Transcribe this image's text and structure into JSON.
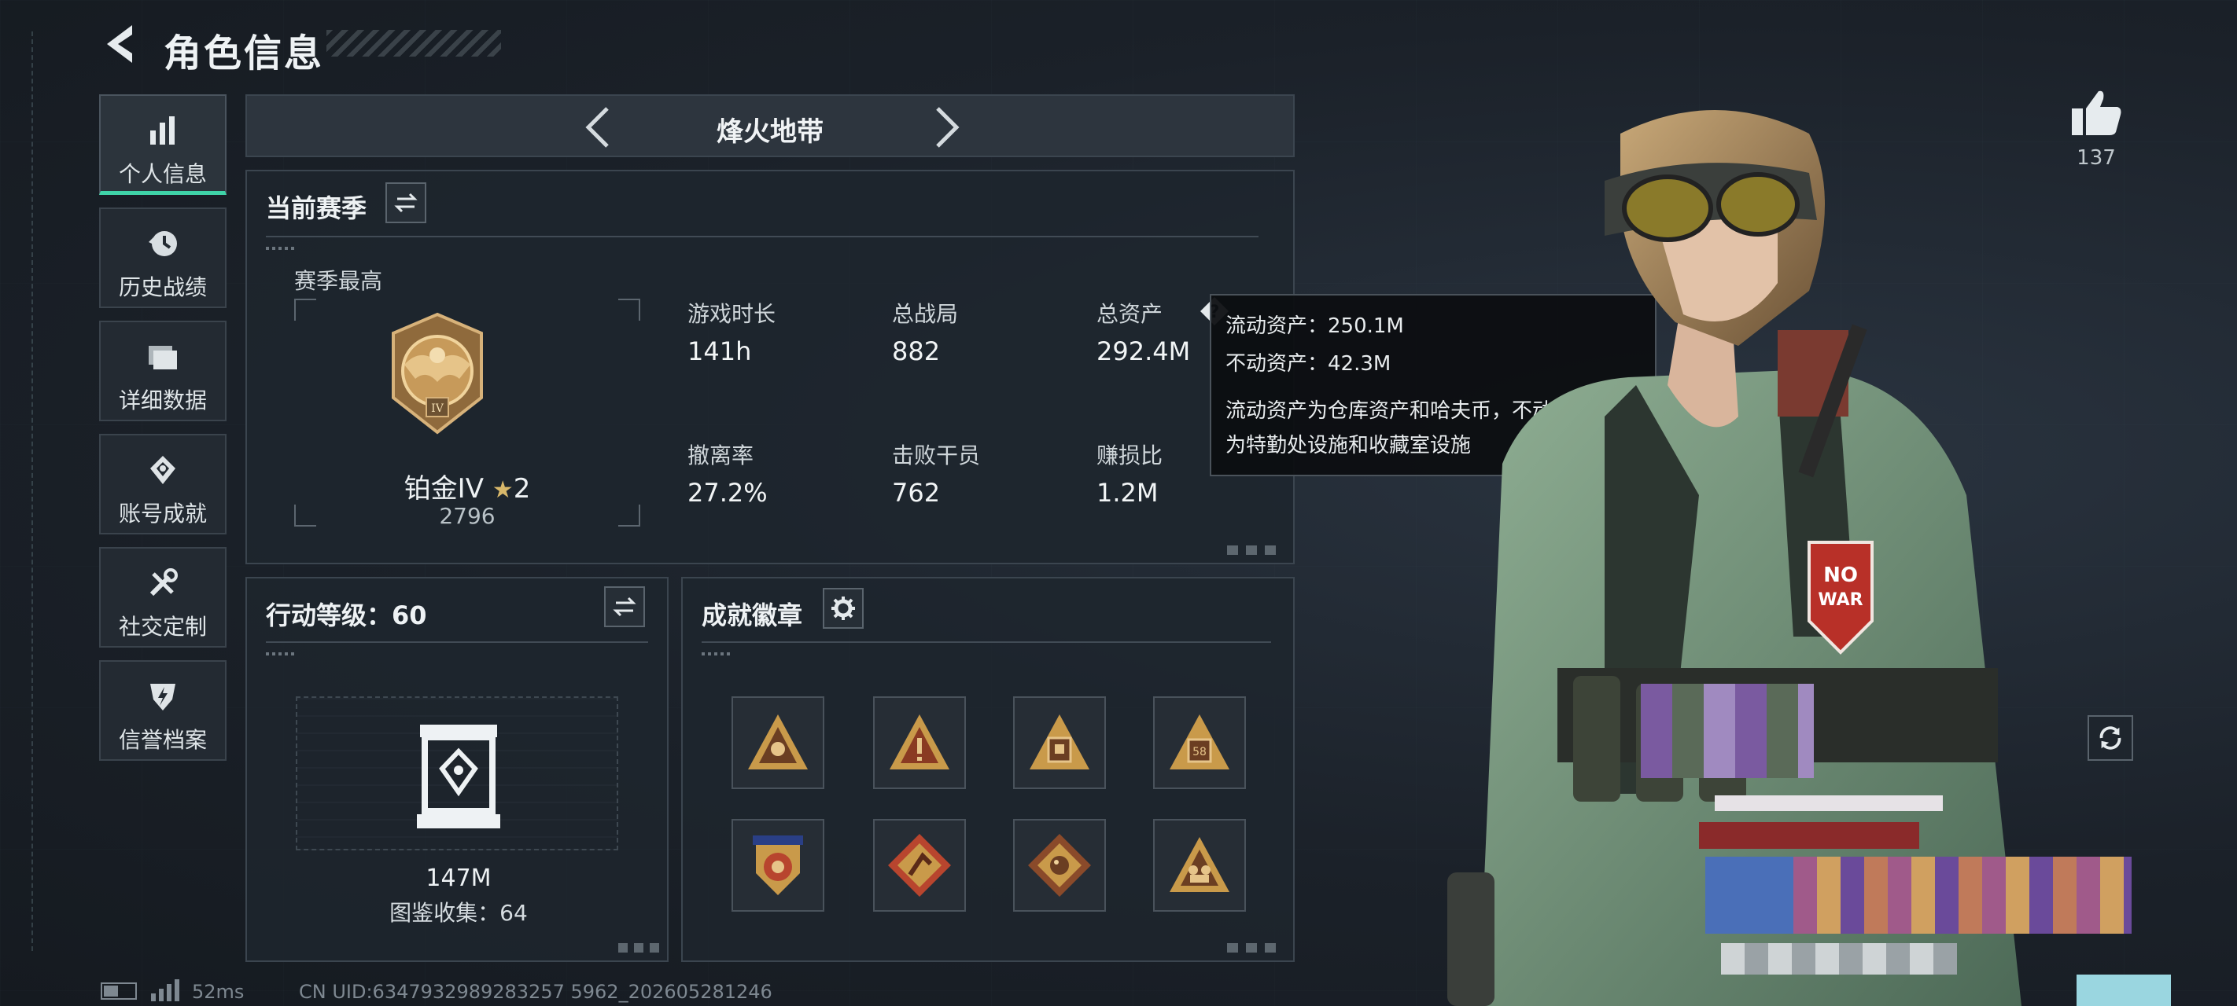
{
  "header": {
    "title": "角色信息"
  },
  "sidebar": {
    "items": [
      {
        "label": "个人信息",
        "icon": "bar-chart-icon",
        "active": true
      },
      {
        "label": "历史战绩",
        "icon": "history-clock-icon",
        "active": false
      },
      {
        "label": "详细数据",
        "icon": "folder-icon",
        "active": false
      },
      {
        "label": "账号成就",
        "icon": "achievement-icon",
        "active": false
      },
      {
        "label": "社交定制",
        "icon": "tools-icon",
        "active": false
      },
      {
        "label": "信誉档案",
        "icon": "shield-bolt-icon",
        "active": false
      }
    ]
  },
  "game_tab": {
    "name": "烽火地带"
  },
  "season": {
    "title": "当前赛季",
    "best_label": "赛季最高",
    "rank_name": "铂金IV",
    "rank_stars": "2",
    "rank_score": "2796",
    "stats": [
      {
        "label": "游戏时长",
        "value": "141h"
      },
      {
        "label": "总战局",
        "value": "882"
      },
      {
        "label": "总资产",
        "value": "292.4M"
      },
      {
        "label": "撤离率",
        "value": "27.2%"
      },
      {
        "label": "击败干员",
        "value": "762"
      },
      {
        "label": "赚损比",
        "value": "1.2M"
      }
    ]
  },
  "tooltip": {
    "line1": "流动资产：250.1M",
    "line2": "不动资产：42.3M",
    "line3": "流动资产为仓库资产和哈夫币，不动资产",
    "line4": "为特勤处设施和收藏室设施"
  },
  "action_level": {
    "title": "行动等级：60",
    "value": "147M",
    "collection": "图鉴收集：64"
  },
  "badges": {
    "title": "成就徽章",
    "colors": {
      "gold": "#c99a4a",
      "red": "#b8452e",
      "blue": "#2a3f86"
    }
  },
  "likes": {
    "count": "137"
  },
  "status": {
    "ping": "52ms",
    "uid": "CN UID:6347932989283257 5962_202605281246"
  },
  "colors": {
    "accent": "#3fd3a8",
    "panel": "#1e252d",
    "background": "#1b2129"
  }
}
